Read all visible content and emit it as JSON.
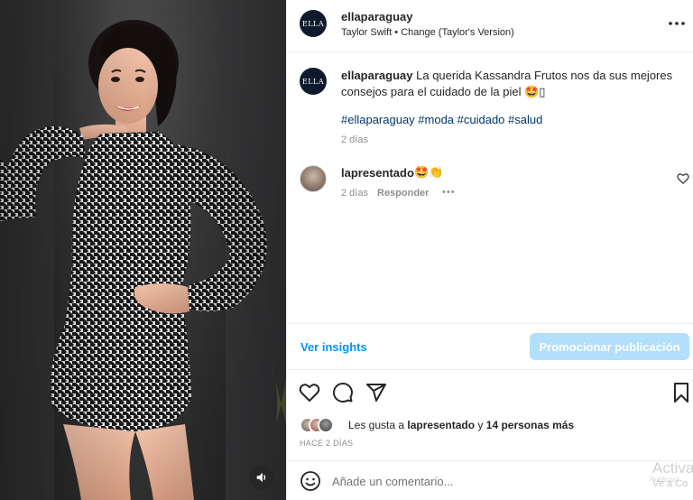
{
  "post": {
    "username": "ellaparaguay",
    "brand_avatar_text": "ELLA",
    "song": "Taylor Swift • Change (Taylor's Version)",
    "caption_username": "ellaparaguay",
    "caption": "La querida Kassandra Frutos nos da sus mejores consejos para el cuidado de la piel 🤩▯",
    "hashtags": "#ellaparaguay #moda #cuidado #salud",
    "caption_time": "2 días"
  },
  "comment": {
    "username": "lapresentado",
    "text": "🤩👏",
    "time": "2 días",
    "reply_label": "Responder",
    "more_label": "•••"
  },
  "insights": {
    "link_label": "Ver insights",
    "promote_label": "Promocionar publicación"
  },
  "likes": {
    "prefix": "Les gusta a ",
    "user": "lapresentado",
    "middle": " y ",
    "others": "14 personas más",
    "date": "HACE 2 DÍAS"
  },
  "add_comment": {
    "placeholder": "Añade un comentario..."
  },
  "watermark": {
    "line1": "Activa",
    "line2": "Ve a Co",
    "line3": "Publicaci"
  },
  "icons": {
    "more": "more-horizontal-icon",
    "sound": "speaker-icon",
    "like": "heart-icon",
    "comment": "comment-icon",
    "share": "paper-plane-icon",
    "save": "bookmark-icon",
    "emoji": "smiley-icon"
  },
  "colors": {
    "link": "#0095f6",
    "promote_bg": "#b2dffc",
    "hashtag": "#00376b",
    "muted": "#8e8e8e",
    "brand_avatar": "#0f1a2e"
  }
}
